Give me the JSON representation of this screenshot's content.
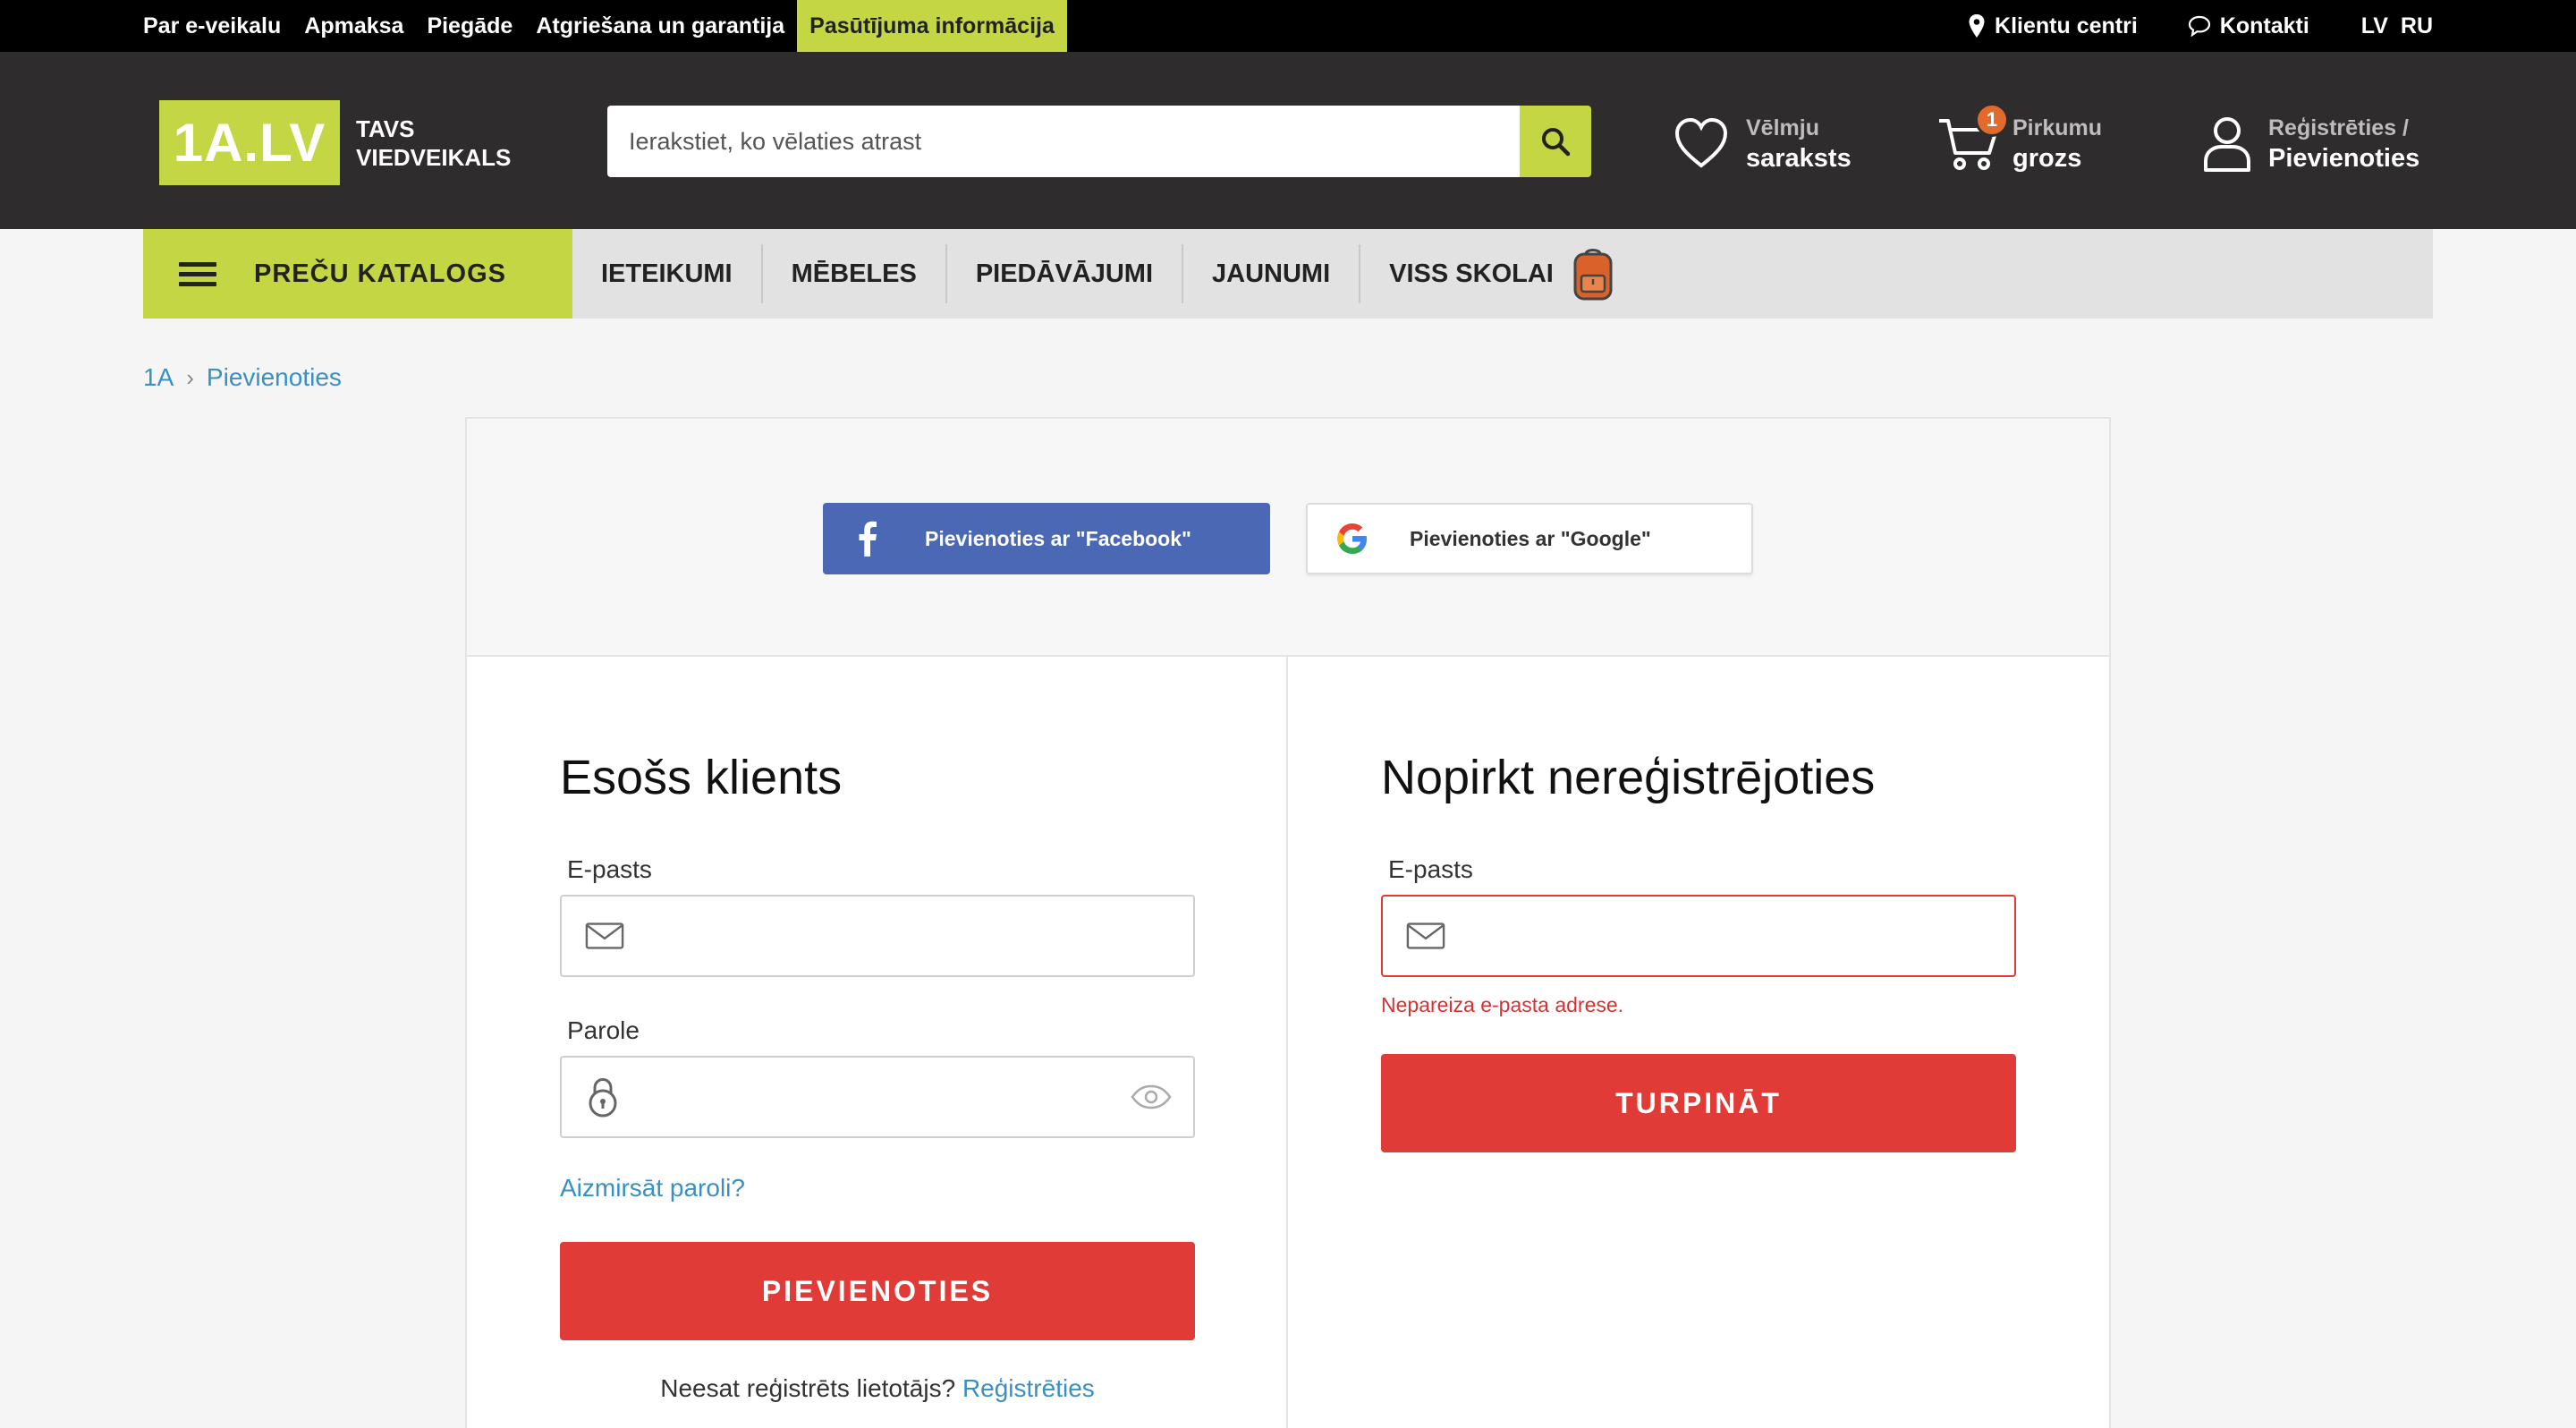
{
  "topbar": {
    "links": [
      "Par e-veikalu",
      "Apmaksa",
      "Piegāde",
      "Atgriešana un garantija",
      "Pasūtījuma informācija"
    ],
    "client_centers": "Klientu centri",
    "contacts": "Kontakti",
    "lang_lv": "LV",
    "lang_ru": "RU"
  },
  "header": {
    "logo_text": "1A.LV",
    "logo_tag_1": "TAVS",
    "logo_tag_2": "VIEDVEIKALS",
    "search_placeholder": "Ierakstiet, ko vēlaties atrast",
    "wishlist_small": "Vēlmju",
    "wishlist_big": "saraksts",
    "cart_small": "Pirkumu",
    "cart_big": "grozs",
    "cart_count": "1",
    "account_small": "Reģistrēties /",
    "account_big": "Pievienoties"
  },
  "catnav": {
    "catalog_label": "PREČU KATALOGS",
    "items": [
      "IETEIKUMI",
      "MĒBELES",
      "PIEDĀVĀJUMI",
      "JAUNUMI",
      "VISS SKOLAI"
    ]
  },
  "breadcrumb": {
    "home": "1A",
    "current": "Pievienoties"
  },
  "social": {
    "facebook_label": "Pievienoties ar \"Facebook\"",
    "google_label": "Pievienoties ar \"Google\""
  },
  "existing": {
    "title": "Esošs klients",
    "email_label": "E-pasts",
    "email_value": "",
    "password_label": "Parole",
    "password_value": "",
    "forgot_link": "Aizmirsāt paroli?",
    "submit_label": "PIEVIENOTIES",
    "register_prompt": "Neesat reģistrēts lietotājs?",
    "register_link": "Reģistrēties"
  },
  "guest": {
    "title": "Nopirkt nereģistrējoties",
    "email_label": "E-pasts",
    "email_value": "",
    "error_message": "Nepareiza e-pasta adrese.",
    "submit_label": "TURPINĀT"
  },
  "colors": {
    "brand_green": "#c4d644",
    "header_dark": "#2e2c2c",
    "action_red": "#e03b36",
    "link_blue": "#3a8fc4",
    "facebook_blue": "#4a68b4",
    "badge_orange": "#e26a2c"
  }
}
